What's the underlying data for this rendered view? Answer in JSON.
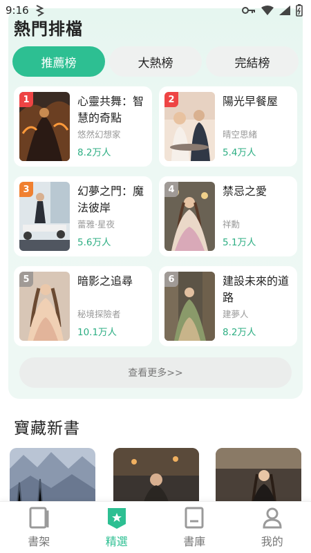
{
  "status": {
    "time": "9:16"
  },
  "ranking": {
    "title": "熱門排檔",
    "tabs": [
      {
        "label": "推薦榜",
        "active": true
      },
      {
        "label": "大熱榜",
        "active": false
      },
      {
        "label": "完結榜",
        "active": false
      }
    ],
    "books": [
      {
        "rank": "1",
        "name": "心靈共舞：智慧的奇點",
        "author": "悠然幻想家",
        "views": "8.2万人",
        "badge_color": "#ee4444"
      },
      {
        "rank": "2",
        "name": "陽光早餐屋",
        "author": "晴空思緒",
        "views": "5.4万人",
        "badge_color": "#ee4444"
      },
      {
        "rank": "3",
        "name": "幻夢之門：魔法彼岸",
        "author": "蕾雅·星夜",
        "views": "5.6万人",
        "badge_color": "#f08030"
      },
      {
        "rank": "4",
        "name": "禁忌之愛",
        "author": "祥勳",
        "views": "5.1万人",
        "badge_color": "#a09a96"
      },
      {
        "rank": "5",
        "name": "暗影之追尋",
        "author": "秘境探險者",
        "views": "10.1万人",
        "badge_color": "#a09a96"
      },
      {
        "rank": "6",
        "name": "建設未來的道路",
        "author": "建夢人",
        "views": "8.2万人",
        "badge_color": "#a09a96"
      }
    ],
    "more_label": "查看更多>>"
  },
  "new_books": {
    "title": "寶藏新書"
  },
  "nav": {
    "items": [
      {
        "label": "書架",
        "icon": "bookshelf-icon",
        "active": false
      },
      {
        "label": "精選",
        "icon": "featured-icon",
        "active": true
      },
      {
        "label": "書庫",
        "icon": "library-icon",
        "active": false
      },
      {
        "label": "我的",
        "icon": "profile-icon",
        "active": false
      }
    ]
  },
  "colors": {
    "accent": "#2dbf92",
    "views": "#2dae83",
    "card_bg": "#e6f6f0"
  }
}
